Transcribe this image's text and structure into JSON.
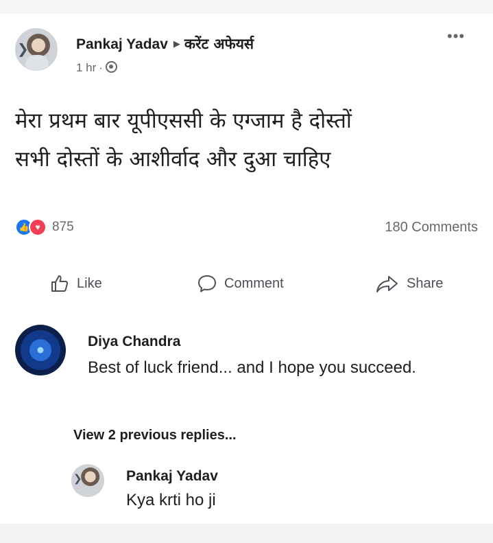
{
  "post": {
    "author": "Pankaj Yadav",
    "group": "करेंट अफेयर्स",
    "time": "1 hr",
    "privacy_icon": "globe-icon",
    "text_line1": "मेरा प्रथम बार यूपीएससी के एग्जाम है दोस्तों",
    "text_line2": "सभी दोस्तों के आशीर्वाद और दुआ चाहिए"
  },
  "reactions": {
    "count": "875",
    "icons": [
      "like-reaction-icon",
      "love-reaction-icon"
    ],
    "comments": "180 Comments"
  },
  "actions": {
    "like": "Like",
    "comment": "Comment",
    "share": "Share"
  },
  "comments": [
    {
      "author": "Diya Chandra",
      "text": "Best of luck friend... and I hope you succeed."
    }
  ],
  "view_replies": "View 2 previous replies...",
  "reply": {
    "author": "Pankaj Yadav",
    "text": "Kya krti ho ji"
  },
  "colors": {
    "like_blue": "#1877f2",
    "love_red": "#f33e58",
    "secondary_text": "#65676b",
    "primary_text": "#1c1e21"
  }
}
